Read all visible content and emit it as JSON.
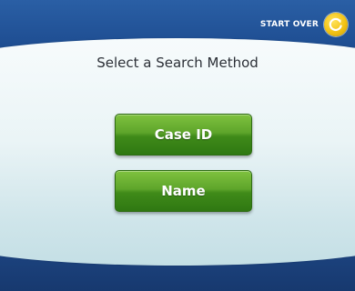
{
  "header": {
    "start_over_label": "START OVER",
    "start_over_icon": "refresh-icon"
  },
  "main": {
    "title": "Select a Search Method",
    "buttons": [
      {
        "label": "Case ID"
      },
      {
        "label": "Name"
      }
    ]
  },
  "colors": {
    "frame_blue": "#1e4d91",
    "panel_light": "#eaf4f6",
    "button_green": "#5ea52b",
    "icon_yellow": "#f2c215"
  }
}
